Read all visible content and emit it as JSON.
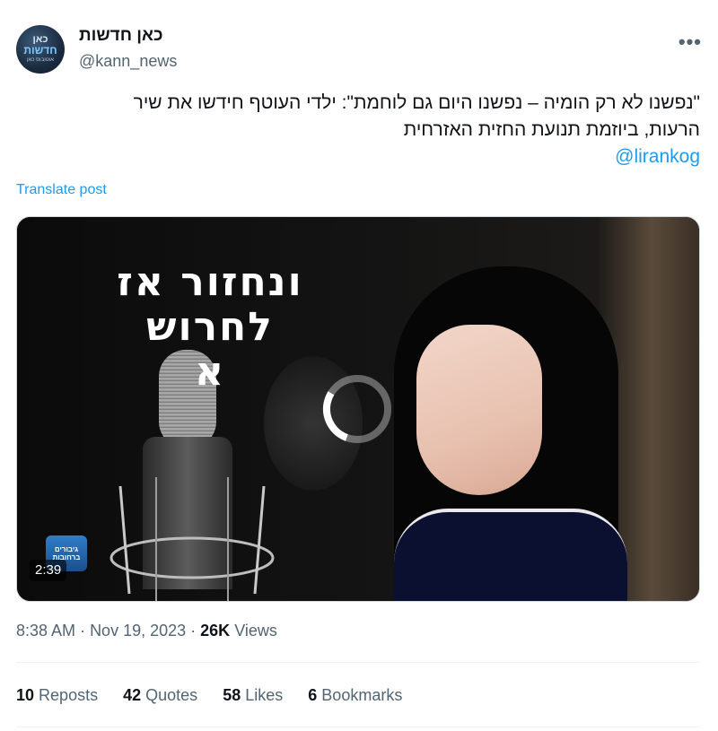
{
  "author": {
    "display_name": "כאן חדשות",
    "handle": "@kann_news",
    "avatar_text": [
      "כאן",
      "חדשות",
      "אוטובוס כאן"
    ]
  },
  "more_icon": "more-horizontal-icon",
  "tweet": {
    "text_line1": "\"נפשנו לא רק הומיה – נפשנו היום גם לוחמת\": ילדי העוטף חידשו את שיר",
    "text_line2": "הרעות, ביוזמת תנועת החזית האזרחית",
    "mention": "@lirankog",
    "translate_label": "Translate post"
  },
  "media": {
    "overlay_text_line1": "ונחזור אז",
    "overlay_text_line2": "לחרוש",
    "overlay_text_line3": "א",
    "badge_text": "גיבורים ברחובות",
    "duration": "2:39",
    "loading_icon": "loading-spinner-icon"
  },
  "meta": {
    "time": "8:38 AM",
    "date": "Nov 19, 2023",
    "views_count": "26K",
    "views_label": "Views"
  },
  "stats": [
    {
      "count": "10",
      "label": "Reposts"
    },
    {
      "count": "42",
      "label": "Quotes"
    },
    {
      "count": "58",
      "label": "Likes"
    },
    {
      "count": "6",
      "label": "Bookmarks"
    }
  ],
  "colors": {
    "accent": "#1d9bf0",
    "secondary_text": "#536471",
    "primary_text": "#0f1419"
  }
}
